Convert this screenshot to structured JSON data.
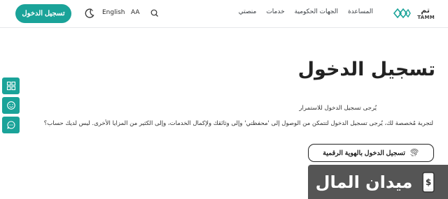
{
  "header": {
    "login_label": "تسجيل الدخول",
    "lang_label": "English",
    "fontsize_label": "AA",
    "nav": [
      "منصتي",
      "خدمات",
      "الجهات الحكومية",
      "المساعدة"
    ],
    "logo_ar": "تم",
    "logo_en": "TAMM"
  },
  "main": {
    "title": "تسجيل الدخول",
    "subtitle": "يُرجى تسجيل الدخول للاستمرار",
    "description": "لتجربة مُخصصة لك، يُرجى تسجيل الدخول لتتمكن من الوصول إلى 'محفظتي' وإلى وثائقك ولإكمال الخدمات، وإلى الكثير من المزايا الأخرى. ليس لديك حساب؟",
    "uaepass_label": "تسجيل الدخول بالهوية الرقمية"
  },
  "watermark": {
    "text": "ميدان المال"
  },
  "colors": {
    "accent": "#1aa399",
    "watermark_bg": "#464646"
  },
  "icons": [
    "moon-icon",
    "search-icon",
    "grid-icon",
    "smile-icon",
    "chat-icon",
    "fingerprint-icon",
    "dollar-phone-icon"
  ]
}
